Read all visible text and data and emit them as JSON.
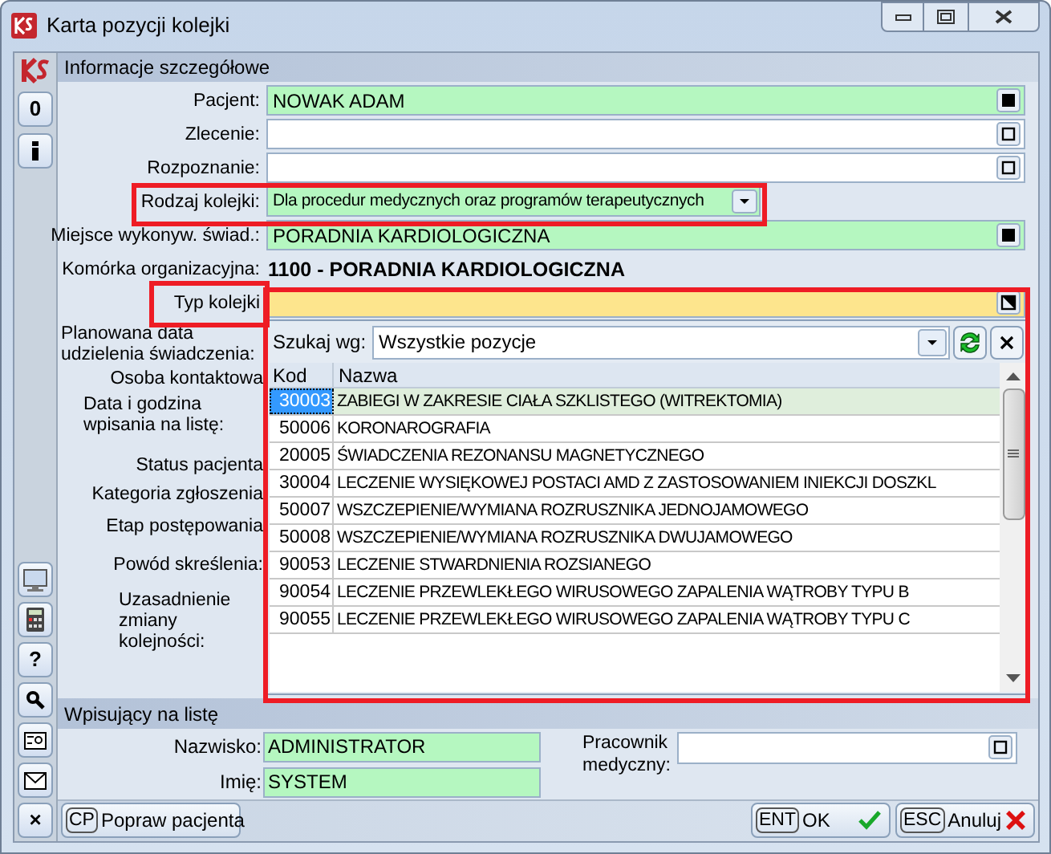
{
  "window": {
    "title": "Karta pozycji kolejki"
  },
  "toolbar_top": [
    {
      "kind": "logo"
    },
    {
      "kind": "text",
      "label": "0"
    },
    {
      "kind": "info"
    }
  ],
  "toolbar_bottom": [
    {
      "kind": "monitor"
    },
    {
      "kind": "calculator"
    },
    {
      "kind": "text",
      "label": "?"
    },
    {
      "kind": "search"
    },
    {
      "kind": "card"
    },
    {
      "kind": "mail"
    },
    {
      "kind": "text",
      "label": "×"
    }
  ],
  "details": {
    "title": "Informacje szczegółowe",
    "fields": [
      {
        "label": "Pacjent:",
        "kind": "lookup",
        "filled": true,
        "focused": false,
        "has_value": true,
        "expandable": false,
        "value": "NOWAK ADAM"
      },
      {
        "label": "Zlecenie:",
        "kind": "lookup",
        "filled": false,
        "focused": false,
        "has_value": false,
        "expandable": false
      },
      {
        "label": "Rozpoznanie:",
        "kind": "lookup",
        "filled": false,
        "focused": false,
        "has_value": false,
        "expandable": false
      },
      {
        "label": "Rodzaj kolejki:",
        "kind": "combo",
        "filled": true,
        "focused": false,
        "value": "Dla procedur medycznych oraz programów terapeutycznych"
      },
      {
        "label": "Miejsce wykonyw. świad.:",
        "kind": "lookup",
        "filled": true,
        "focused": false,
        "has_value": true,
        "expandable": false,
        "value": "PORADNIA KARDIOLOGICZNA"
      },
      {
        "label": "Komórka organizacyjna:",
        "kind": "static",
        "value": "1100 - PORADNIA KARDIOLOGICZNA"
      },
      {
        "label": "Typ kolejki",
        "kind": "lookup",
        "focused": true,
        "expandable": true
      }
    ],
    "more_labels": [
      "Planowana data udzielenia świadczenia:",
      "Osoba kontaktowa",
      "Data i godzina wpisania na listę:",
      "Status pacjenta",
      "Kategoria zgłoszenia",
      "Etap postępowania",
      "Powód skreślenia:",
      "Uzasadnienie zmiany kolejności:"
    ]
  },
  "picker": {
    "search_label": "Szukaj wg:",
    "search_value": "Wszystkie pozycje",
    "columns": [
      "Kod",
      "Nazwa"
    ],
    "rows": [
      {
        "code": "30003",
        "name": "ZABIEGI W ZAKRESIE CIAŁA SZKLISTEGO (WITREKTOMIA)",
        "selected": true
      },
      {
        "code": "50006",
        "name": "KORONAROGRAFIA",
        "selected": false
      },
      {
        "code": "20005",
        "name": "ŚWIADCZENIA REZONANSU MAGNETYCZNEGO",
        "selected": false
      },
      {
        "code": "30004",
        "name": "LECZENIE WYSIĘKOWEJ POSTACI AMD Z ZASTOSOWANIEM INIEKCJI DOSZKL",
        "selected": false
      },
      {
        "code": "50007",
        "name": "WSZCZEPIENIE/WYMIANA ROZRUSZNIKA JEDNOJAMOWEGO",
        "selected": false
      },
      {
        "code": "50008",
        "name": "WSZCZEPIENIE/WYMIANA ROZRUSZNIKA DWUJAMOWEGO",
        "selected": false
      },
      {
        "code": "90053",
        "name": "LECZENIE STWARDNIENIA ROZSIANEGO",
        "selected": false
      },
      {
        "code": "90054",
        "name": "LECZENIE PRZEWLEKŁEGO WIRUSOWEGO ZAPALENIA WĄTROBY TYPU B",
        "selected": false
      },
      {
        "code": "90055",
        "name": "LECZENIE PRZEWLEKŁEGO WIRUSOWEGO ZAPALENIA WĄTROBY TYPU C",
        "selected": false
      }
    ]
  },
  "writer": {
    "title": "Wpisujący na listę",
    "surname_label": "Nazwisko:",
    "surname": "ADMINISTRATOR",
    "name_label": "Imię:",
    "name": "SYSTEM",
    "staff_label": "Pracownik medyczny:"
  },
  "buttons": [
    {
      "key": "CP",
      "label": "Popraw pacjenta"
    },
    {
      "key": "ENT",
      "label": "OK"
    },
    {
      "key": "ESC",
      "label": "Anuluj"
    }
  ]
}
